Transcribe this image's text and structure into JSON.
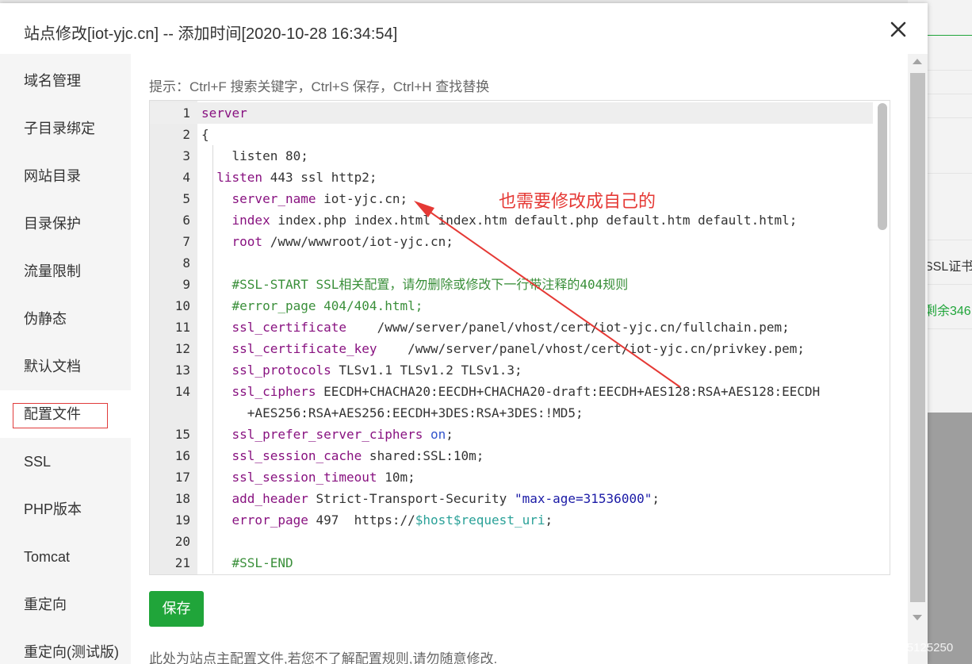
{
  "modal": {
    "title": "站点修改[iot-yjc.cn] -- 添加时间[2020-10-28 16:34:54]"
  },
  "sidebar": {
    "items": [
      {
        "label": "域名管理"
      },
      {
        "label": "子目录绑定"
      },
      {
        "label": "网站目录"
      },
      {
        "label": "目录保护"
      },
      {
        "label": "流量限制"
      },
      {
        "label": "伪静态"
      },
      {
        "label": "默认文档"
      },
      {
        "label": "配置文件"
      },
      {
        "label": "SSL"
      },
      {
        "label": "PHP版本"
      },
      {
        "label": "Tomcat"
      },
      {
        "label": "重定向"
      },
      {
        "label": "重定向(测试版)"
      }
    ],
    "active_index": 7
  },
  "content": {
    "hint": "提示：Ctrl+F 搜索关键字，Ctrl+S 保存，Ctrl+H 查找替换",
    "save_label": "保存",
    "footer_note": "此处为站点主配置文件,若您不了解配置规则,请勿随意修改."
  },
  "editor": {
    "lines": [
      {
        "n": "1",
        "t": [
          {
            "c": "kw",
            "v": "server"
          }
        ]
      },
      {
        "n": "2",
        "t": [
          {
            "c": "",
            "v": "{"
          }
        ]
      },
      {
        "n": "3",
        "t": [
          {
            "c": "",
            "v": "    listen 80;"
          }
        ]
      },
      {
        "n": "4",
        "t": [
          {
            "c": "",
            "v": "  "
          },
          {
            "c": "kw",
            "v": "listen"
          },
          {
            "c": "",
            "v": " 443 ssl http2;"
          }
        ]
      },
      {
        "n": "5",
        "t": [
          {
            "c": "",
            "v": "    "
          },
          {
            "c": "kw",
            "v": "server_name"
          },
          {
            "c": "",
            "v": " iot-yjc.cn;"
          }
        ]
      },
      {
        "n": "6",
        "t": [
          {
            "c": "",
            "v": "    "
          },
          {
            "c": "kw",
            "v": "index"
          },
          {
            "c": "",
            "v": " index.php index.html index.htm default.php default.htm default.html;"
          }
        ]
      },
      {
        "n": "7",
        "t": [
          {
            "c": "",
            "v": "    "
          },
          {
            "c": "kw",
            "v": "root"
          },
          {
            "c": "",
            "v": " /www/wwwroot/iot-yjc.cn;"
          }
        ]
      },
      {
        "n": "8",
        "t": [
          {
            "c": "",
            "v": ""
          }
        ]
      },
      {
        "n": "9",
        "t": [
          {
            "c": "",
            "v": "    "
          },
          {
            "c": "cm",
            "v": "#SSL-START SSL相关配置，请勿删除或修改下一行带注释的404规则"
          }
        ]
      },
      {
        "n": "10",
        "t": [
          {
            "c": "",
            "v": "    "
          },
          {
            "c": "cm",
            "v": "#error_page 404/404.html;"
          }
        ]
      },
      {
        "n": "11",
        "t": [
          {
            "c": "",
            "v": "    "
          },
          {
            "c": "kw",
            "v": "ssl_certificate"
          },
          {
            "c": "",
            "v": "    /www/server/panel/vhost/cert/iot-yjc.cn/fullchain.pem;"
          }
        ]
      },
      {
        "n": "12",
        "t": [
          {
            "c": "",
            "v": "    "
          },
          {
            "c": "kw",
            "v": "ssl_certificate_key"
          },
          {
            "c": "",
            "v": "    /www/server/panel/vhost/cert/iot-yjc.cn/privkey.pem;"
          }
        ]
      },
      {
        "n": "13",
        "t": [
          {
            "c": "",
            "v": "    "
          },
          {
            "c": "kw",
            "v": "ssl_protocols"
          },
          {
            "c": "",
            "v": " TLSv1.1 TLSv1.2 TLSv1.3;"
          }
        ]
      },
      {
        "n": "14",
        "t": [
          {
            "c": "",
            "v": "    "
          },
          {
            "c": "kw",
            "v": "ssl_ciphers"
          },
          {
            "c": "",
            "v": " EECDH+CHACHA20:EECDH+CHACHA20-draft:EECDH+AES128:RSA+AES128:EECDH"
          }
        ]
      },
      {
        "n": "",
        "t": [
          {
            "c": "",
            "v": "      +AES256:RSA+AES256:EECDH+3DES:RSA+3DES:!MD5;"
          }
        ]
      },
      {
        "n": "15",
        "t": [
          {
            "c": "",
            "v": "    "
          },
          {
            "c": "kw",
            "v": "ssl_prefer_server_ciphers"
          },
          {
            "c": "",
            "v": " "
          },
          {
            "c": "bl",
            "v": "on"
          },
          {
            "c": "",
            "v": ";"
          }
        ]
      },
      {
        "n": "16",
        "t": [
          {
            "c": "",
            "v": "    "
          },
          {
            "c": "kw",
            "v": "ssl_session_cache"
          },
          {
            "c": "",
            "v": " shared:SSL:10m;"
          }
        ]
      },
      {
        "n": "17",
        "t": [
          {
            "c": "",
            "v": "    "
          },
          {
            "c": "kw",
            "v": "ssl_session_timeout"
          },
          {
            "c": "",
            "v": " 10m;"
          }
        ]
      },
      {
        "n": "18",
        "t": [
          {
            "c": "",
            "v": "    "
          },
          {
            "c": "kw",
            "v": "add_header"
          },
          {
            "c": "",
            "v": " Strict-Transport-Security "
          },
          {
            "c": "str",
            "v": "\"max-age=31536000\""
          },
          {
            "c": "",
            "v": ";"
          }
        ]
      },
      {
        "n": "19",
        "t": [
          {
            "c": "",
            "v": "    "
          },
          {
            "c": "kw",
            "v": "error_page"
          },
          {
            "c": "",
            "v": " 497  https://"
          },
          {
            "c": "vr",
            "v": "$host$request_uri"
          },
          {
            "c": "",
            "v": ";"
          }
        ]
      },
      {
        "n": "20",
        "t": [
          {
            "c": "",
            "v": ""
          }
        ]
      },
      {
        "n": "21",
        "t": [
          {
            "c": "",
            "v": "    "
          },
          {
            "c": "cm",
            "v": "#SSL-END"
          }
        ]
      }
    ],
    "active_line": 0
  },
  "annotation": {
    "text": "也需要修改成自己的"
  },
  "background": {
    "ssl_label": "SSL证书",
    "remaining_label": "剩余346"
  },
  "watermark": "https://blog.csdn.net/qq_45125250",
  "colors": {
    "accent_green": "#20a53a",
    "annotation_red": "#e53935"
  }
}
